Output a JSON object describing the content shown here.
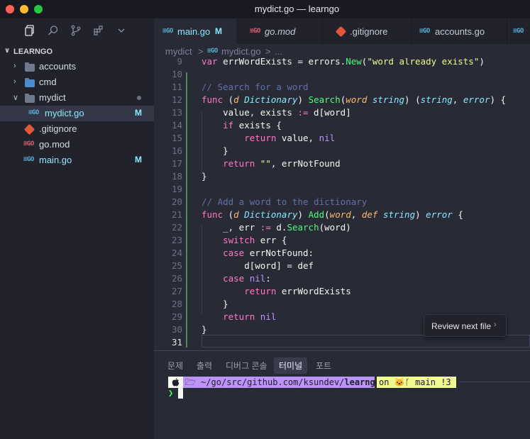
{
  "window": {
    "title": "mydict.go — learngo"
  },
  "colors": {
    "accent": "#8be9fd",
    "modified": "#8be9fd",
    "prompt": "#50fa7b",
    "path_bg": "#bd93f9",
    "git_bg": "#f1fa8c"
  },
  "activity": [
    "files-icon",
    "search-icon",
    "source-control-icon",
    "extensions-icon",
    "chevron-down-icon"
  ],
  "explorer": {
    "root": "LEARNGO",
    "items": [
      {
        "label": "accounts",
        "kind": "folder",
        "badge": ""
      },
      {
        "label": "cmd",
        "kind": "folder",
        "badge": ""
      },
      {
        "label": "mydict",
        "kind": "folder-open",
        "badge": ""
      },
      {
        "label": "mydict.go",
        "kind": "go",
        "badge": "M"
      },
      {
        "label": ".gitignore",
        "kind": "git",
        "badge": ""
      },
      {
        "label": "go.mod",
        "kind": "gomod",
        "badge": ""
      },
      {
        "label": "main.go",
        "kind": "go",
        "badge": "M"
      }
    ]
  },
  "tabs": [
    {
      "label": "main.go",
      "mark": "M",
      "icon": "go-icon"
    },
    {
      "label": "go.mod",
      "mark": "",
      "icon": "go-mod-icon"
    },
    {
      "label": ".gitignore",
      "mark": "",
      "icon": "git-icon"
    },
    {
      "label": "accounts.go",
      "mark": "",
      "icon": "go-icon"
    }
  ],
  "breadcrumb": {
    "folder": "mydict",
    "sep1": ">",
    "file": "mydict.go",
    "sep2": ">",
    "more": "..."
  },
  "editor": {
    "line_numbers": [
      "9",
      "10",
      "11",
      "12",
      "13",
      "14",
      "15",
      "16",
      "17",
      "18",
      "19",
      "20",
      "21",
      "22",
      "23",
      "24",
      "25",
      "26",
      "27",
      "28",
      "29",
      "30",
      "31"
    ],
    "lines": [
      "var errWordExists = errors.New(\"word already exists\")",
      "",
      "// Search for a word",
      "func (d Dictionary) Search(word string) (string, error) {",
      "    value, exists := d[word]",
      "    if exists {",
      "        return value, nil",
      "    }",
      "    return \"\", errNotFound",
      "}",
      "",
      "// Add a word to the dictionary",
      "func (d Dictionary) Add(word, def string) error {",
      "    _, err := d.Search(word)",
      "    switch err {",
      "    case errNotFound:",
      "        d[word] = def",
      "    case nil:",
      "        return errWordExists",
      "    }",
      "    return nil",
      "}",
      ""
    ]
  },
  "review_button": {
    "label": "Review next file",
    "chevron": "›"
  },
  "panel": {
    "tabs": [
      "문제",
      "출력",
      "디버그 콘솔",
      "터미널",
      "포트"
    ],
    "active_tab": "터미널",
    "terminal": {
      "os_glyph": "",
      "path_prefix": "~/go/src/github.com/ksundev/",
      "path_bold": "learngo",
      "git_on": "on",
      "git_branch": "main !3",
      "prompt_symbol": "❯"
    }
  }
}
